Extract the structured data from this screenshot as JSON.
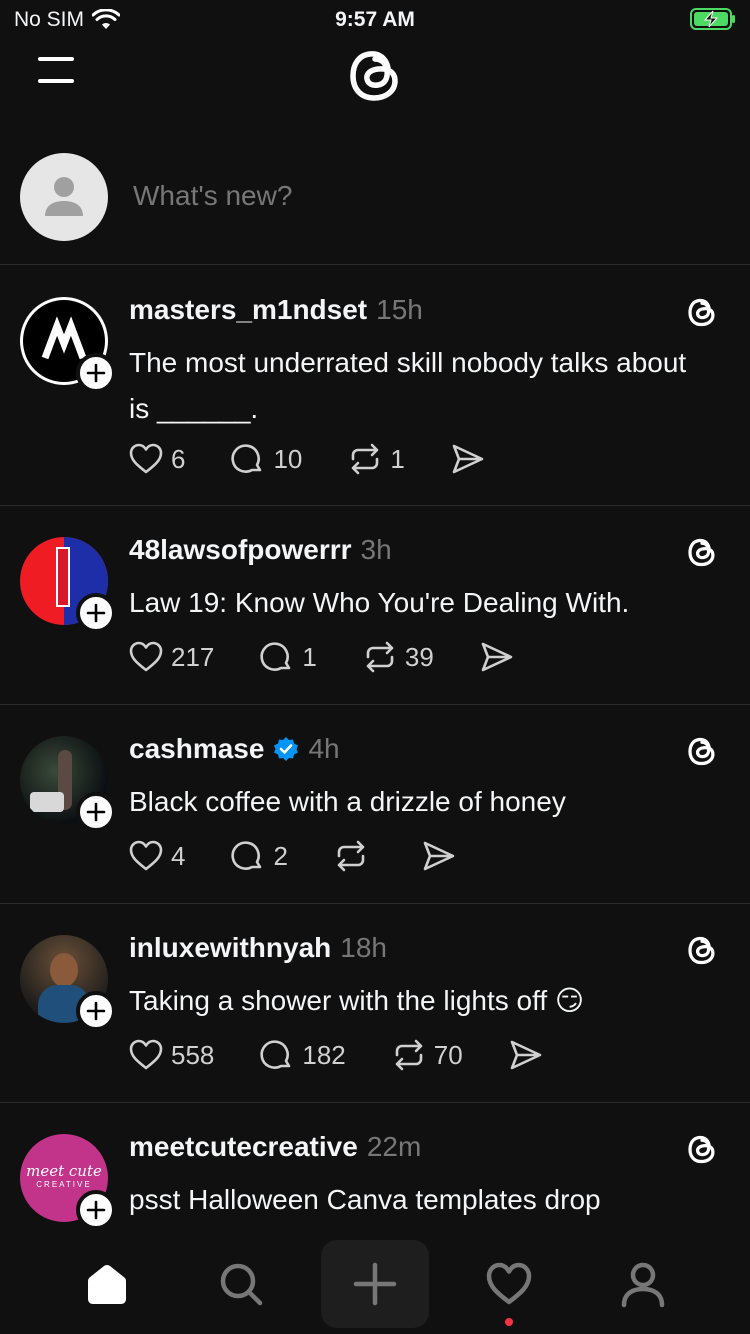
{
  "status_bar": {
    "carrier": "No SIM",
    "time": "9:57 AM",
    "wifi_icon": "wifi-icon",
    "battery_icon": "battery-charging-icon",
    "battery_color": "#4cd964"
  },
  "header": {
    "menu_icon": "menu-icon",
    "logo_icon": "threads-logo-icon"
  },
  "composer": {
    "placeholder": "What's new?"
  },
  "posts": [
    {
      "username": "masters_m1ndset",
      "time": "15h",
      "verified": false,
      "text": "The most underrated skill nobody talks about is ______.",
      "likes": "6",
      "replies": "10",
      "reposts": "1"
    },
    {
      "username": "48lawsofpowerrr",
      "time": "3h",
      "verified": false,
      "text": "Law 19: Know Who You're Dealing With.",
      "likes": "217",
      "replies": "1",
      "reposts": "39"
    },
    {
      "username": "cashmase",
      "time": "4h",
      "verified": true,
      "text": "Black coffee with a drizzle of honey",
      "likes": "4",
      "replies": "2",
      "reposts": ""
    },
    {
      "username": "inluxewithnyah",
      "time": "18h",
      "verified": false,
      "text": "Taking a shower with the lights off 😏",
      "likes": "558",
      "replies": "182",
      "reposts": "70"
    },
    {
      "username": "meetcutecreative",
      "time": "22m",
      "verified": false,
      "text": "psst Halloween Canva templates drop tomorrow 👀",
      "avatar_text": "meet cute",
      "avatar_subtext": "CREATIVE"
    }
  ],
  "tab_bar": {
    "tabs": [
      "home-icon",
      "search-icon",
      "create-icon",
      "activity-icon",
      "profile-icon"
    ],
    "notification_dot_color": "#ff3040"
  },
  "colors": {
    "background": "#101010",
    "text_primary": "#f3f5f7",
    "text_secondary": "#777777",
    "verified": "#0095f6"
  }
}
